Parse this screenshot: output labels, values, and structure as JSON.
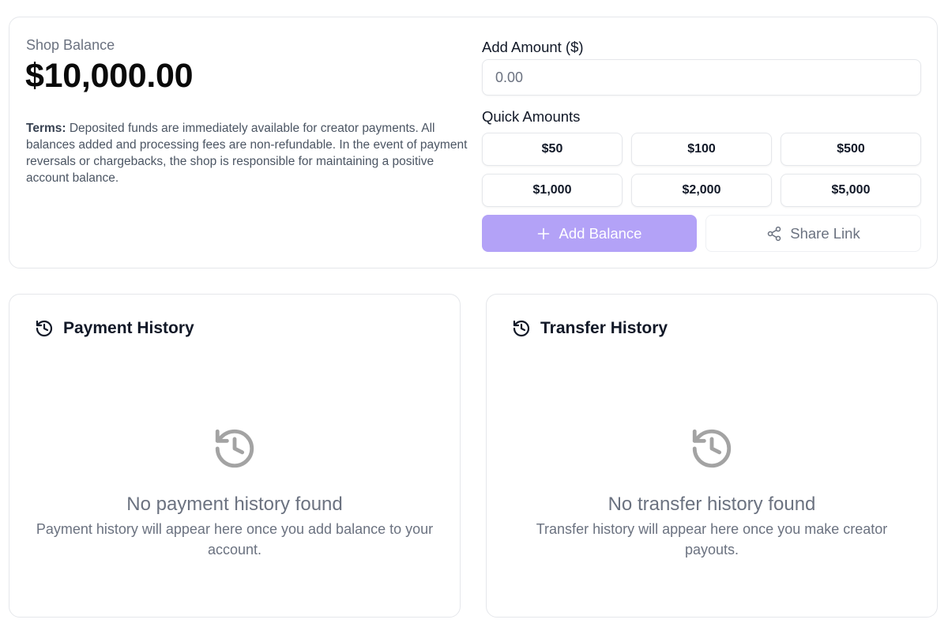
{
  "balance": {
    "label": "Shop Balance",
    "amount": "$10,000.00",
    "terms_bold": "Terms:",
    "terms_text": " Deposited funds are immediately available for creator payments. All balances added and processing fees are non-refundable. In the event of payment reversals or chargebacks, the shop is responsible for maintaining a positive account balance."
  },
  "add_amount": {
    "label": "Add Amount ($)",
    "placeholder": "0.00"
  },
  "quick_amounts": {
    "label": "Quick Amounts",
    "options": [
      "$50",
      "$100",
      "$500",
      "$1,000",
      "$2,000",
      "$5,000"
    ]
  },
  "actions": {
    "add_balance": "Add Balance",
    "add_icon": "plus-icon",
    "share_link": "Share Link",
    "share_icon": "share-icon",
    "add_button_color": "#b3a2f7"
  },
  "payment_history": {
    "title": "Payment History",
    "icon": "history-icon",
    "empty_title": "No payment history found",
    "empty_desc": "Payment history will appear here once you add balance to your account."
  },
  "transfer_history": {
    "title": "Transfer History",
    "icon": "history-icon",
    "empty_title": "No transfer history found",
    "empty_desc": "Transfer history will appear here once you make creator payouts."
  }
}
